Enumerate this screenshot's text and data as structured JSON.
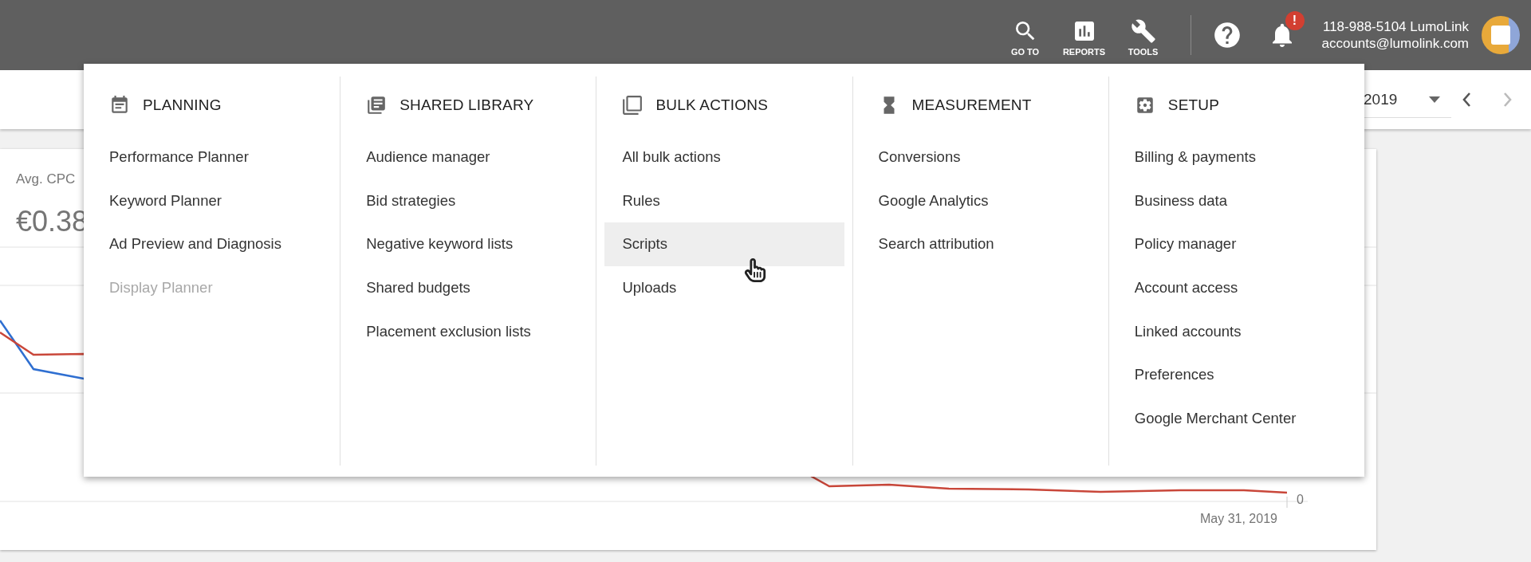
{
  "top_bar": {
    "tools": [
      {
        "label": "GO TO"
      },
      {
        "label": "REPORTS"
      },
      {
        "label": "TOOLS"
      }
    ],
    "notification_badge": "!",
    "account": {
      "name": "118-988-5104 LumoLink",
      "email": "accounts@lumolink.com"
    }
  },
  "date_range": {
    "value": "2019",
    "next_disabled": true
  },
  "card": {
    "metric": "Avg. CPC",
    "value": "€0.38",
    "axis_zero": "0",
    "end_date": "May 31, 2019"
  },
  "menu": {
    "columns": [
      {
        "title": "PLANNING",
        "items": [
          {
            "label": "Performance Planner",
            "disabled": false,
            "highlighted": false
          },
          {
            "label": "Keyword Planner",
            "disabled": false,
            "highlighted": false
          },
          {
            "label": "Ad Preview and Diagnosis",
            "disabled": false,
            "highlighted": false
          },
          {
            "label": "Display Planner",
            "disabled": true,
            "highlighted": false
          }
        ]
      },
      {
        "title": "SHARED LIBRARY",
        "items": [
          {
            "label": "Audience manager",
            "disabled": false,
            "highlighted": false
          },
          {
            "label": "Bid strategies",
            "disabled": false,
            "highlighted": false
          },
          {
            "label": "Negative keyword lists",
            "disabled": false,
            "highlighted": false
          },
          {
            "label": "Shared budgets",
            "disabled": false,
            "highlighted": false
          },
          {
            "label": "Placement exclusion lists",
            "disabled": false,
            "highlighted": false
          }
        ]
      },
      {
        "title": "BULK ACTIONS",
        "items": [
          {
            "label": "All bulk actions",
            "disabled": false,
            "highlighted": false
          },
          {
            "label": "Rules",
            "disabled": false,
            "highlighted": false
          },
          {
            "label": "Scripts",
            "disabled": false,
            "highlighted": true
          },
          {
            "label": "Uploads",
            "disabled": false,
            "highlighted": false
          }
        ]
      },
      {
        "title": "MEASUREMENT",
        "items": [
          {
            "label": "Conversions",
            "disabled": false,
            "highlighted": false
          },
          {
            "label": "Google Analytics",
            "disabled": false,
            "highlighted": false
          },
          {
            "label": "Search attribution",
            "disabled": false,
            "highlighted": false
          }
        ]
      },
      {
        "title": "SETUP",
        "items": [
          {
            "label": "Billing & payments",
            "disabled": false,
            "highlighted": false
          },
          {
            "label": "Business data",
            "disabled": false,
            "highlighted": false
          },
          {
            "label": "Policy manager",
            "disabled": false,
            "highlighted": false
          },
          {
            "label": "Account access",
            "disabled": false,
            "highlighted": false
          },
          {
            "label": "Linked accounts",
            "disabled": false,
            "highlighted": false
          },
          {
            "label": "Preferences",
            "disabled": false,
            "highlighted": false
          },
          {
            "label": "Google Merchant Center",
            "disabled": false,
            "highlighted": false
          }
        ]
      }
    ]
  }
}
